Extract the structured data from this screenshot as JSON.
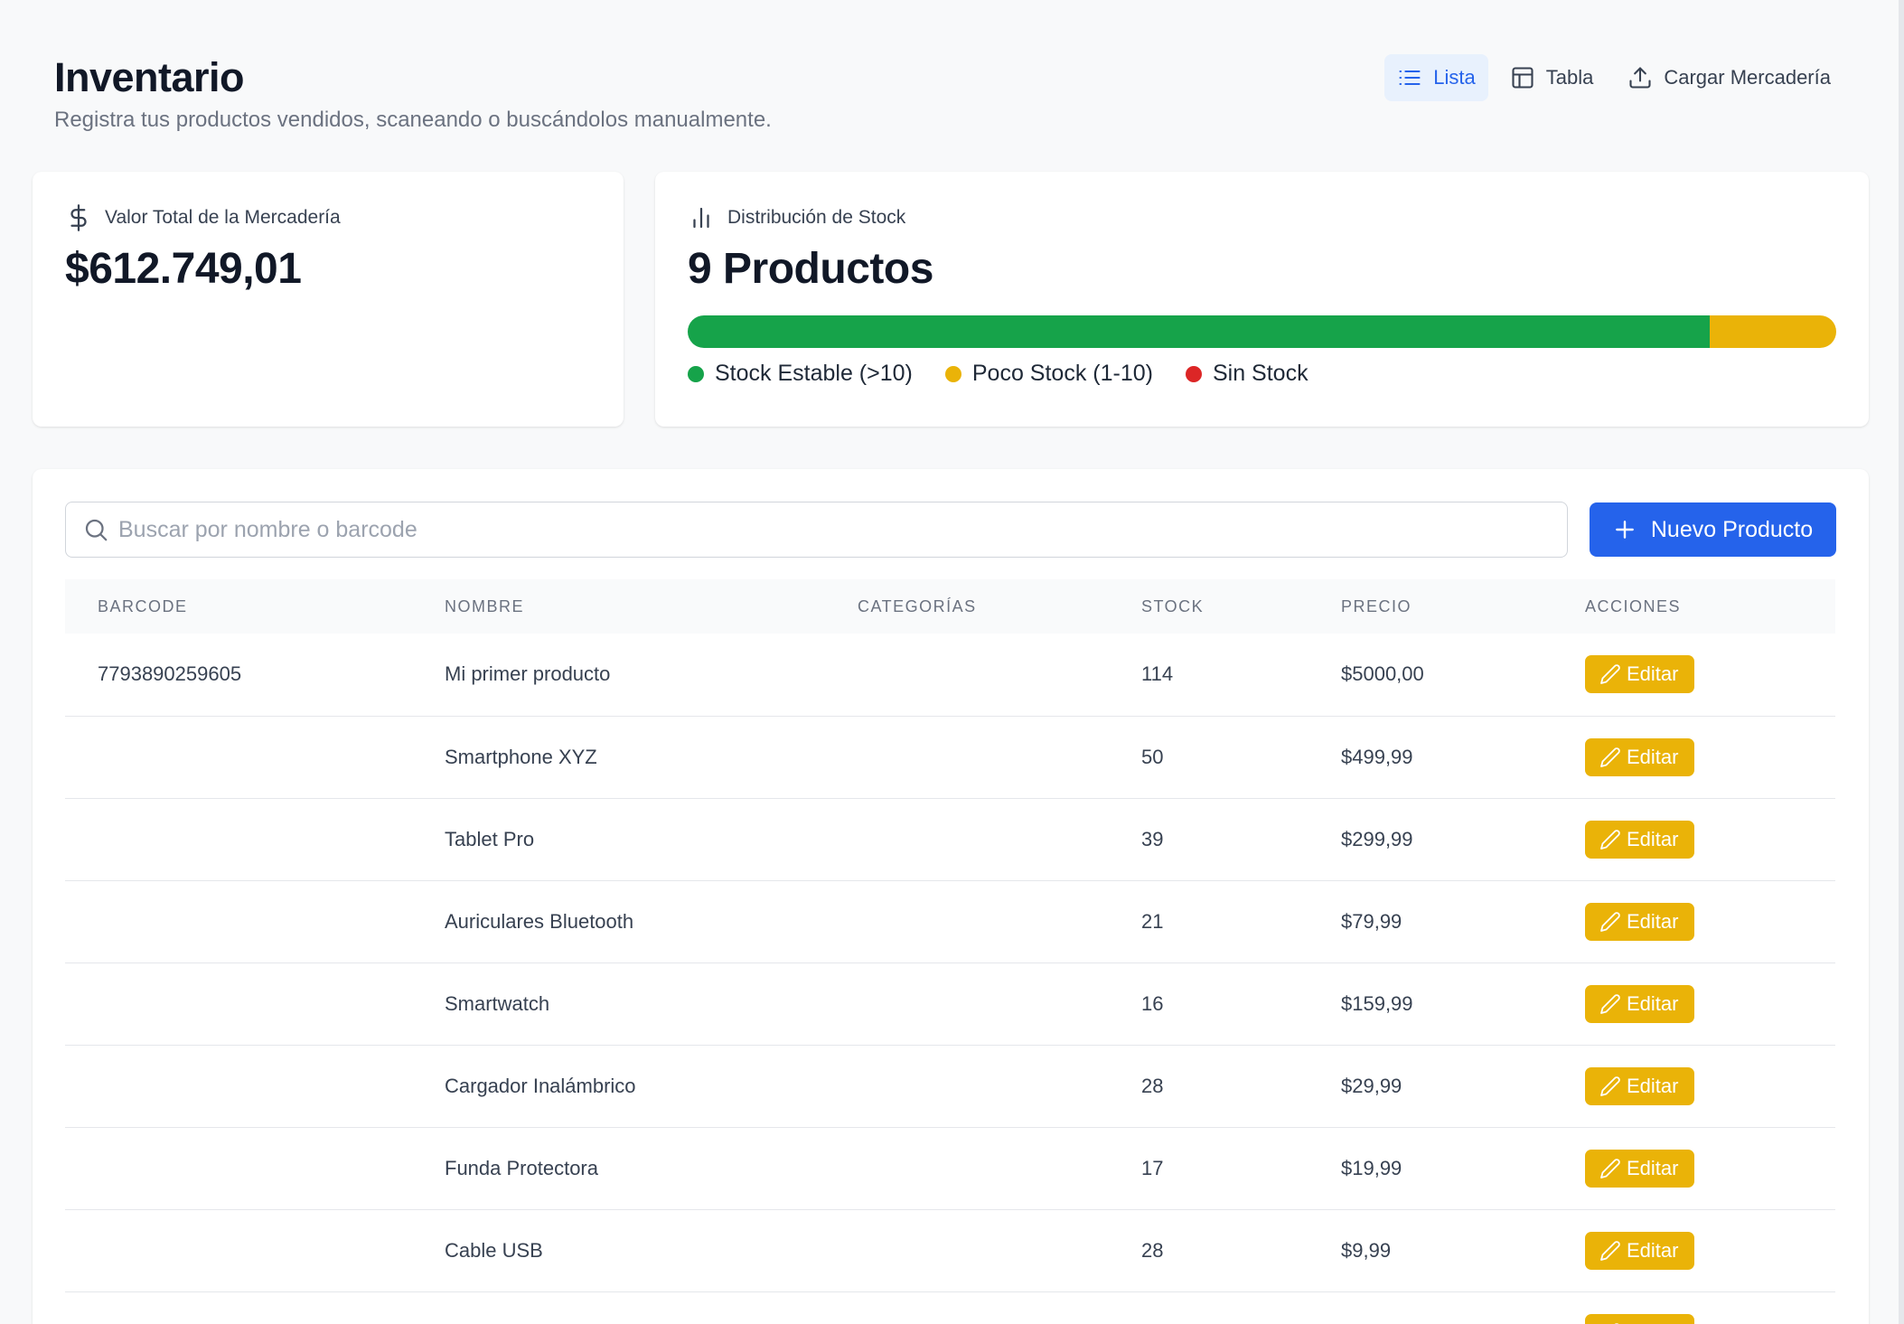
{
  "header": {
    "title": "Inventario",
    "subtitle": "Registra tus productos vendidos, scaneando o buscándolos manualmente.",
    "views": [
      {
        "label": "Lista",
        "icon": "list-icon",
        "active": true
      },
      {
        "label": "Tabla",
        "icon": "table-icon",
        "active": false
      },
      {
        "label": "Cargar Mercadería",
        "icon": "upload-icon",
        "active": false
      }
    ]
  },
  "value_card": {
    "label": "Valor Total de la Mercadería",
    "icon": "dollar-icon",
    "value": "$612.749,01"
  },
  "distribution_card": {
    "label": "Distribución de Stock",
    "icon": "bar-chart-icon",
    "value": "9 Productos",
    "segments": [
      {
        "label": "Stock Estable (>10)",
        "fraction": 0.89,
        "color": "#16a34a"
      },
      {
        "label": "Poco Stock (1-10)",
        "fraction": 0.11,
        "color": "#eab308"
      },
      {
        "label": "Sin Stock",
        "fraction": 0,
        "color": "#dc2626"
      }
    ]
  },
  "toolbar": {
    "search_placeholder": "Buscar por nombre o barcode",
    "search_value": "",
    "new_button": "Nuevo Producto"
  },
  "table": {
    "columns": [
      "BARCODE",
      "NOMBRE",
      "CATEGORÍAS",
      "STOCK",
      "PRECIO",
      "ACCIONES"
    ],
    "rows": [
      {
        "barcode": "7793890259605",
        "name": "Mi primer producto",
        "categories": "",
        "stock": "114",
        "price": "$5000,00",
        "action": "Editar"
      },
      {
        "barcode": "",
        "name": "Smartphone XYZ",
        "categories": "",
        "stock": "50",
        "price": "$499,99",
        "action": "Editar"
      },
      {
        "barcode": "",
        "name": "Tablet Pro",
        "categories": "",
        "stock": "39",
        "price": "$299,99",
        "action": "Editar"
      },
      {
        "barcode": "",
        "name": "Auriculares Bluetooth",
        "categories": "",
        "stock": "21",
        "price": "$79,99",
        "action": "Editar"
      },
      {
        "barcode": "",
        "name": "Smartwatch",
        "categories": "",
        "stock": "16",
        "price": "$159,99",
        "action": "Editar"
      },
      {
        "barcode": "",
        "name": "Cargador Inalámbrico",
        "categories": "",
        "stock": "28",
        "price": "$29,99",
        "action": "Editar"
      },
      {
        "barcode": "",
        "name": "Funda Protectora",
        "categories": "",
        "stock": "17",
        "price": "$19,99",
        "action": "Editar"
      },
      {
        "barcode": "",
        "name": "Cable USB",
        "categories": "",
        "stock": "28",
        "price": "$9,99",
        "action": "Editar"
      },
      {
        "barcode": "",
        "name": "",
        "categories": "",
        "stock": "",
        "price": "",
        "action": "Editar"
      }
    ]
  }
}
